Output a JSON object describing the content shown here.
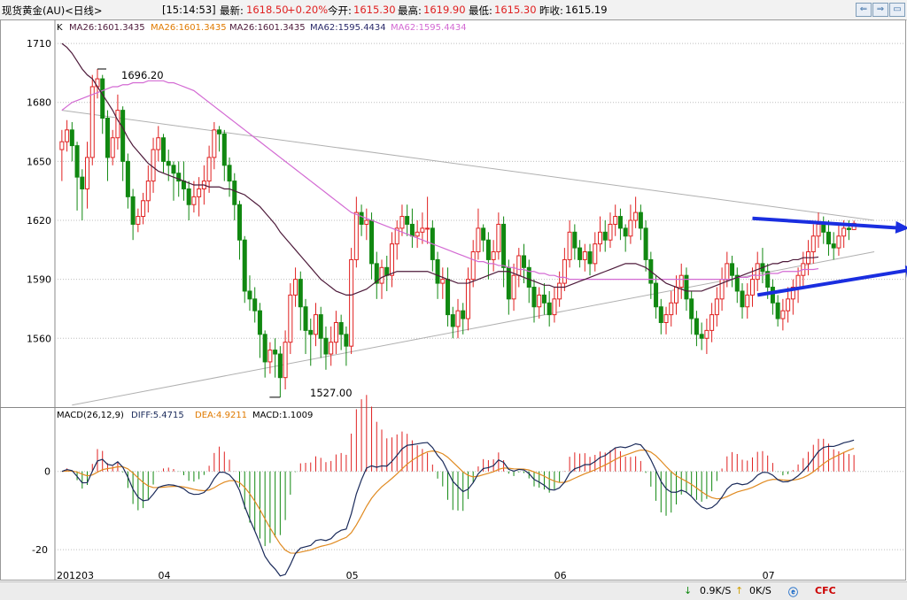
{
  "header": {
    "symbol": "现货黄金(AU)<日线>",
    "time": "[15:14:53]",
    "latest_label": "最新:",
    "latest_value": "1618.50",
    "change": "+0.20%",
    "open_label": "今开:",
    "open_value": "1615.30",
    "high_label": "最高:",
    "high_value": "1619.90",
    "low_label": "最低:",
    "low_value": "1615.30",
    "prev_label": "昨收:",
    "prev_value": "1615.19"
  },
  "window_buttons": [
    "⇐",
    "⇒",
    "▭"
  ],
  "legend": {
    "k_label": "K",
    "ma_items": [
      {
        "text": "MA26:1601.3435",
        "color": "#4d1a3a"
      },
      {
        "text": "MA26:1601.3435",
        "color": "#e07a00"
      },
      {
        "text": "MA26:1601.3435",
        "color": "#4d1a3a"
      },
      {
        "text": "MA62:1595.4434",
        "color": "#2a2a6a"
      },
      {
        "text": "MA62:1595.4434",
        "color": "#d36ad3"
      }
    ]
  },
  "macd_legend": {
    "title": "MACD(26,12,9)",
    "diff": "DIFF:5.4715",
    "dea": "DEA:4.9211",
    "macd": "MACD:1.1009"
  },
  "annotations": {
    "high_label": "1696.20",
    "low_label": "1527.00"
  },
  "status": {
    "down_speed": "0.9K/S",
    "up_speed": "0K/S",
    "cfc": "CFC"
  },
  "colors": {
    "up": "#e02020",
    "down": "#118811",
    "ma26": "#4d1a3a",
    "ma62": "#d36ad3",
    "diff": "#1a2a5a",
    "dea": "#e08a20",
    "arrow": "#1a2ee0",
    "trend": "#b0b0b0"
  },
  "chart_data": [
    {
      "type": "candlestick",
      "title": "现货黄金(AU)<日线>",
      "ylim": [
        1525,
        1715
      ],
      "y_ticks": [
        1560,
        1590,
        1620,
        1650,
        1680,
        1710
      ],
      "x_labels": [
        {
          "index": 0,
          "label": "201203"
        },
        {
          "index": 20,
          "label": "04"
        },
        {
          "index": 57,
          "label": "05"
        },
        {
          "index": 98,
          "label": "06"
        },
        {
          "index": 139,
          "label": "07"
        }
      ],
      "series_names": [
        "MA26",
        "MA62"
      ],
      "candles": [
        [
          1656,
          1660,
          1666,
          1640
        ],
        [
          1660,
          1666,
          1671,
          1655
        ],
        [
          1666,
          1658,
          1670,
          1650
        ],
        [
          1658,
          1642,
          1660,
          1625
        ],
        [
          1642,
          1636,
          1646,
          1620
        ],
        [
          1636,
          1652,
          1660,
          1626
        ],
        [
          1652,
          1688,
          1694,
          1648
        ],
        [
          1688,
          1692,
          1697,
          1682
        ],
        [
          1692,
          1672,
          1694,
          1664
        ],
        [
          1672,
          1652,
          1676,
          1640
        ],
        [
          1652,
          1662,
          1666,
          1648
        ],
        [
          1662,
          1676,
          1684,
          1656
        ],
        [
          1676,
          1650,
          1678,
          1640
        ],
        [
          1650,
          1632,
          1654,
          1626
        ],
        [
          1632,
          1618,
          1636,
          1610
        ],
        [
          1618,
          1622,
          1626,
          1614
        ],
        [
          1622,
          1630,
          1634,
          1618
        ],
        [
          1630,
          1640,
          1648,
          1624
        ],
        [
          1640,
          1656,
          1662,
          1634
        ],
        [
          1656,
          1662,
          1668,
          1650
        ],
        [
          1662,
          1650,
          1664,
          1644
        ],
        [
          1650,
          1648,
          1656,
          1640
        ],
        [
          1648,
          1644,
          1650,
          1630
        ],
        [
          1644,
          1640,
          1650,
          1632
        ],
        [
          1640,
          1636,
          1650,
          1630
        ],
        [
          1636,
          1628,
          1640,
          1620
        ],
        [
          1628,
          1632,
          1640,
          1624
        ],
        [
          1632,
          1636,
          1642,
          1622
        ],
        [
          1636,
          1640,
          1648,
          1628
        ],
        [
          1640,
          1652,
          1658,
          1634
        ],
        [
          1652,
          1666,
          1670,
          1646
        ],
        [
          1666,
          1664,
          1668,
          1655
        ],
        [
          1664,
          1648,
          1666,
          1640
        ],
        [
          1648,
          1640,
          1652,
          1632
        ],
        [
          1640,
          1628,
          1644,
          1620
        ],
        [
          1628,
          1610,
          1630,
          1600
        ],
        [
          1610,
          1584,
          1612,
          1578
        ],
        [
          1584,
          1580,
          1592,
          1574
        ],
        [
          1580,
          1574,
          1586,
          1568
        ],
        [
          1574,
          1562,
          1578,
          1550
        ],
        [
          1562,
          1548,
          1564,
          1540
        ],
        [
          1548,
          1554,
          1558,
          1542
        ],
        [
          1554,
          1552,
          1560,
          1540
        ],
        [
          1552,
          1540,
          1556,
          1530
        ],
        [
          1540,
          1558,
          1564,
          1534
        ],
        [
          1558,
          1582,
          1588,
          1552
        ],
        [
          1582,
          1590,
          1596,
          1576
        ],
        [
          1590,
          1576,
          1594,
          1564
        ],
        [
          1576,
          1564,
          1580,
          1552
        ],
        [
          1564,
          1562,
          1570,
          1546
        ],
        [
          1562,
          1572,
          1578,
          1556
        ],
        [
          1572,
          1560,
          1576,
          1550
        ],
        [
          1560,
          1552,
          1566,
          1544
        ],
        [
          1552,
          1558,
          1566,
          1546
        ],
        [
          1558,
          1568,
          1574,
          1552
        ],
        [
          1568,
          1562,
          1572,
          1554
        ],
        [
          1562,
          1556,
          1566,
          1546
        ],
        [
          1556,
          1600,
          1606,
          1552
        ],
        [
          1600,
          1624,
          1632,
          1596
        ],
        [
          1624,
          1618,
          1628,
          1612
        ],
        [
          1618,
          1620,
          1626,
          1610
        ],
        [
          1620,
          1598,
          1624,
          1590
        ],
        [
          1598,
          1588,
          1604,
          1580
        ],
        [
          1588,
          1596,
          1600,
          1580
        ],
        [
          1596,
          1592,
          1602,
          1584
        ],
        [
          1592,
          1608,
          1614,
          1586
        ],
        [
          1608,
          1616,
          1620,
          1600
        ],
        [
          1616,
          1622,
          1628,
          1612
        ],
        [
          1622,
          1618,
          1628,
          1612
        ],
        [
          1618,
          1612,
          1626,
          1606
        ],
        [
          1612,
          1614,
          1620,
          1606
        ],
        [
          1614,
          1616,
          1624,
          1608
        ],
        [
          1616,
          1616,
          1632,
          1608
        ],
        [
          1616,
          1600,
          1620,
          1594
        ],
        [
          1600,
          1588,
          1604,
          1580
        ],
        [
          1588,
          1590,
          1596,
          1580
        ],
        [
          1590,
          1572,
          1596,
          1566
        ],
        [
          1572,
          1566,
          1576,
          1560
        ],
        [
          1566,
          1574,
          1580,
          1560
        ],
        [
          1574,
          1570,
          1578,
          1562
        ],
        [
          1570,
          1590,
          1596,
          1564
        ],
        [
          1590,
          1604,
          1610,
          1586
        ],
        [
          1604,
          1616,
          1626,
          1600
        ],
        [
          1616,
          1610,
          1618,
          1604
        ],
        [
          1610,
          1600,
          1614,
          1590
        ],
        [
          1600,
          1604,
          1610,
          1594
        ],
        [
          1604,
          1618,
          1624,
          1600
        ],
        [
          1618,
          1596,
          1622,
          1586
        ],
        [
          1596,
          1580,
          1600,
          1572
        ],
        [
          1580,
          1592,
          1598,
          1574
        ],
        [
          1592,
          1602,
          1606,
          1586
        ],
        [
          1602,
          1596,
          1608,
          1588
        ],
        [
          1596,
          1586,
          1600,
          1578
        ],
        [
          1586,
          1576,
          1590,
          1568
        ],
        [
          1576,
          1582,
          1586,
          1570
        ],
        [
          1582,
          1578,
          1588,
          1572
        ],
        [
          1578,
          1572,
          1584,
          1566
        ],
        [
          1572,
          1580,
          1586,
          1568
        ],
        [
          1580,
          1588,
          1594,
          1576
        ],
        [
          1588,
          1600,
          1606,
          1584
        ],
        [
          1600,
          1614,
          1620,
          1596
        ],
        [
          1614,
          1606,
          1618,
          1600
        ],
        [
          1606,
          1600,
          1610,
          1596
        ],
        [
          1600,
          1604,
          1608,
          1594
        ],
        [
          1604,
          1598,
          1608,
          1592
        ],
        [
          1598,
          1608,
          1614,
          1594
        ],
        [
          1608,
          1614,
          1622,
          1604
        ],
        [
          1614,
          1610,
          1620,
          1604
        ],
        [
          1610,
          1618,
          1624,
          1606
        ],
        [
          1618,
          1622,
          1628,
          1612
        ],
        [
          1622,
          1616,
          1626,
          1610
        ],
        [
          1616,
          1612,
          1618,
          1604
        ],
        [
          1612,
          1620,
          1628,
          1608
        ],
        [
          1620,
          1624,
          1632,
          1616
        ],
        [
          1624,
          1616,
          1628,
          1610
        ],
        [
          1616,
          1600,
          1620,
          1594
        ],
        [
          1600,
          1588,
          1604,
          1580
        ],
        [
          1588,
          1576,
          1592,
          1570
        ],
        [
          1576,
          1568,
          1580,
          1562
        ],
        [
          1568,
          1572,
          1576,
          1562
        ],
        [
          1572,
          1578,
          1584,
          1566
        ],
        [
          1578,
          1586,
          1592,
          1572
        ],
        [
          1586,
          1592,
          1598,
          1580
        ],
        [
          1592,
          1580,
          1596,
          1574
        ],
        [
          1580,
          1570,
          1584,
          1562
        ],
        [
          1570,
          1562,
          1574,
          1556
        ],
        [
          1562,
          1560,
          1568,
          1554
        ],
        [
          1560,
          1564,
          1570,
          1552
        ],
        [
          1564,
          1572,
          1578,
          1558
        ],
        [
          1572,
          1580,
          1586,
          1566
        ],
        [
          1580,
          1590,
          1596,
          1574
        ],
        [
          1590,
          1598,
          1604,
          1586
        ],
        [
          1598,
          1592,
          1602,
          1586
        ],
        [
          1592,
          1584,
          1596,
          1578
        ],
        [
          1584,
          1576,
          1588,
          1570
        ],
        [
          1576,
          1582,
          1588,
          1570
        ],
        [
          1582,
          1590,
          1596,
          1576
        ],
        [
          1590,
          1598,
          1604,
          1584
        ],
        [
          1598,
          1594,
          1606,
          1588
        ],
        [
          1594,
          1586,
          1598,
          1580
        ],
        [
          1586,
          1578,
          1590,
          1572
        ],
        [
          1578,
          1570,
          1582,
          1566
        ],
        [
          1570,
          1574,
          1580,
          1564
        ],
        [
          1574,
          1580,
          1586,
          1568
        ],
        [
          1580,
          1586,
          1590,
          1572
        ],
        [
          1586,
          1592,
          1596,
          1578
        ],
        [
          1592,
          1598,
          1604,
          1586
        ],
        [
          1598,
          1604,
          1610,
          1592
        ],
        [
          1604,
          1612,
          1618,
          1598
        ],
        [
          1612,
          1618,
          1624,
          1606
        ],
        [
          1618,
          1614,
          1622,
          1608
        ],
        [
          1614,
          1608,
          1620,
          1602
        ],
        [
          1608,
          1606,
          1614,
          1600
        ],
        [
          1606,
          1612,
          1618,
          1602
        ],
        [
          1612,
          1616,
          1620,
          1606
        ],
        [
          1616,
          1615.3,
          1620,
          1610
        ],
        [
          1615.3,
          1618.5,
          1619.9,
          1615.3
        ]
      ],
      "ma26": [
        1710,
        1708,
        1705,
        1701,
        1697,
        1694,
        1692,
        1688,
        1684,
        1680,
        1676,
        1671,
        1667,
        1662,
        1658,
        1655,
        1652,
        1649,
        1647,
        1645,
        1644,
        1643,
        1642,
        1641,
        1640,
        1639,
        1638,
        1638,
        1638,
        1637,
        1637,
        1637,
        1636,
        1636,
        1635,
        1634,
        1633,
        1631,
        1629,
        1627,
        1624,
        1621,
        1618,
        1614,
        1611,
        1608,
        1605,
        1602,
        1599,
        1596,
        1593,
        1590,
        1588,
        1586,
        1584,
        1583,
        1582,
        1582,
        1583,
        1584,
        1585,
        1587,
        1589,
        1591,
        1592,
        1593,
        1594,
        1594,
        1594,
        1594,
        1594,
        1594,
        1594,
        1593,
        1592,
        1591,
        1590,
        1589,
        1588,
        1588,
        1588,
        1589,
        1590,
        1591,
        1592,
        1593,
        1594,
        1594,
        1594,
        1593,
        1592,
        1591,
        1590,
        1589,
        1588,
        1587,
        1587,
        1586,
        1586,
        1586,
        1587,
        1588,
        1589,
        1590,
        1591,
        1592,
        1593,
        1594,
        1595,
        1596,
        1597,
        1598,
        1598,
        1598,
        1597,
        1596,
        1594,
        1592,
        1590,
        1588,
        1587,
        1586,
        1585,
        1584,
        1584,
        1584,
        1584,
        1585,
        1586,
        1587,
        1588,
        1589,
        1590,
        1591,
        1592,
        1593,
        1594,
        1595,
        1596,
        1597,
        1598,
        1598,
        1599,
        1599,
        1600,
        1600,
        1601,
        1601,
        1601,
        1601.34
      ],
      "ma62": [
        1676,
        1678,
        1680,
        1681,
        1682,
        1683,
        1684,
        1685,
        1686,
        1687,
        1688,
        1688,
        1689,
        1689,
        1690,
        1690,
        1690,
        1691,
        1691,
        1691,
        1691,
        1690,
        1690,
        1689,
        1688,
        1687,
        1686,
        1684,
        1682,
        1680,
        1678,
        1676,
        1674,
        1672,
        1670,
        1668,
        1666,
        1664,
        1662,
        1660,
        1658,
        1656,
        1654,
        1652,
        1650,
        1648,
        1646,
        1644,
        1642,
        1640,
        1638,
        1636,
        1634,
        1632,
        1630,
        1628,
        1626,
        1624,
        1623,
        1622,
        1621,
        1620,
        1619,
        1618,
        1617,
        1616,
        1615,
        1614,
        1613,
        1612,
        1611,
        1610,
        1609,
        1608,
        1607,
        1606,
        1605,
        1604,
        1603,
        1602,
        1601,
        1600,
        1599,
        1599,
        1598,
        1598,
        1597,
        1597,
        1596,
        1596,
        1595,
        1595,
        1594,
        1594,
        1593,
        1593,
        1592,
        1592,
        1591,
        1591,
        1590,
        1590,
        1590,
        1590,
        1590,
        1590,
        1590,
        1590,
        1590,
        1590,
        1590,
        1590,
        1590,
        1590,
        1590,
        1590,
        1590,
        1590,
        1590,
        1590,
        1590,
        1590,
        1590,
        1590,
        1590,
        1590,
        1590,
        1590,
        1590,
        1590,
        1590,
        1590,
        1590,
        1591,
        1591,
        1591,
        1592,
        1592,
        1592,
        1593,
        1593,
        1593,
        1594,
        1594,
        1594,
        1594,
        1595,
        1595,
        1595,
        1595.44
      ]
    },
    {
      "type": "macd",
      "ylim": [
        -27,
        16
      ],
      "y_ticks": [
        -20,
        0
      ],
      "diff_last": 5.4715,
      "dea_last": 4.9211,
      "macd_last": 1.1009
    }
  ]
}
